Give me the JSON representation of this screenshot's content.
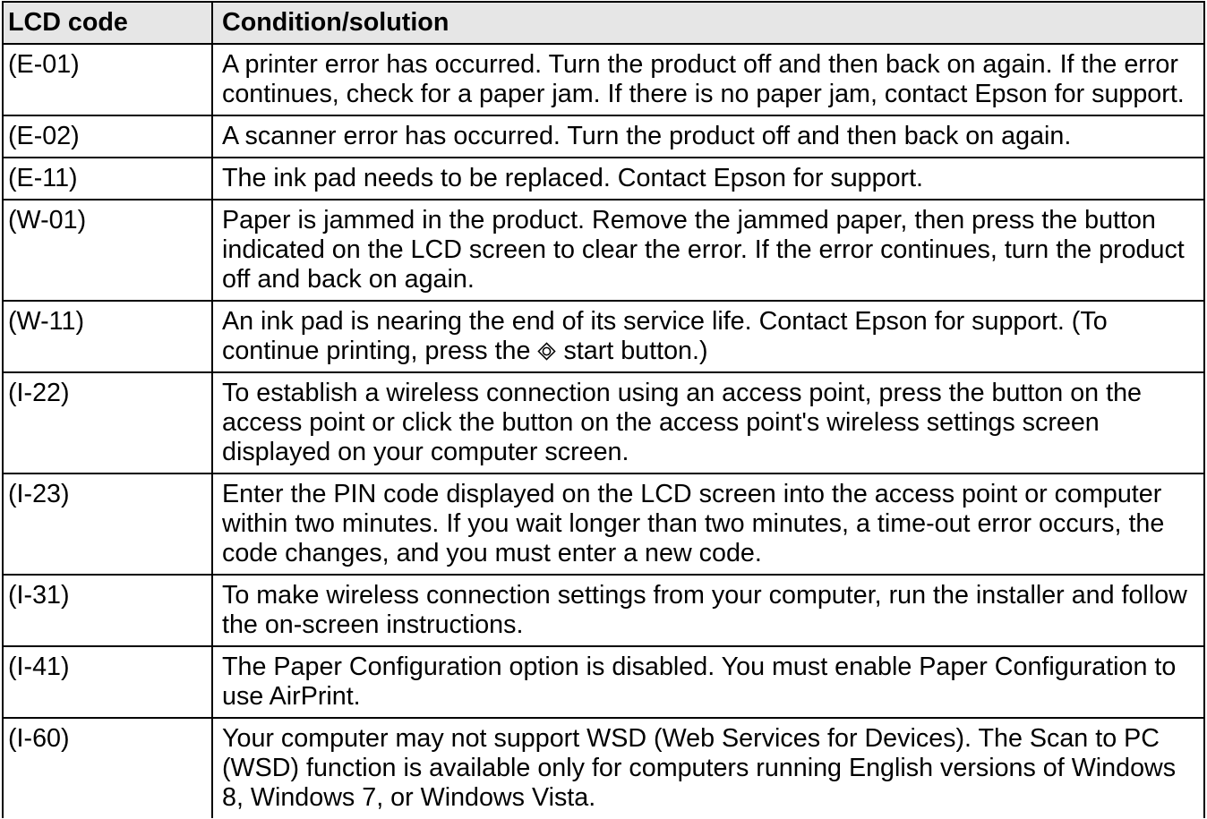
{
  "colors": {
    "header_background": "#e6e6e6",
    "border": "#000000",
    "text": "#000000"
  },
  "table": {
    "headers": {
      "code": "LCD code",
      "solution": "Condition/solution"
    },
    "rows": [
      {
        "code": "(E-01)",
        "solution_lines": [
          "A printer error has occurred. Turn the product off and then back on again. If the error",
          "continues, check for a paper jam. If there is no paper jam, contact Epson for support."
        ]
      },
      {
        "code": "(E-02)",
        "solution_lines": [
          "A scanner error has occurred. Turn the product off and then back on again."
        ]
      },
      {
        "code": "(E-11)",
        "solution_lines": [
          "The ink pad needs to be replaced. Contact Epson for support."
        ]
      },
      {
        "code": "(W-01)",
        "solution_lines": [
          "Paper is jammed in the product. Remove the jammed paper, then press the button",
          "indicated on the LCD screen to clear the error. If the error continues, turn the product",
          "off and back on again."
        ]
      },
      {
        "code": "(W-11)",
        "solution_lines": [
          "An ink pad is nearing the end of its service life. Contact Epson for support. (To"
        ],
        "icon_line": {
          "before": "continue printing, press the",
          "icon": "start-icon",
          "after": "start button.)"
        }
      },
      {
        "code": "(I-22)",
        "solution_lines": [
          "To establish a wireless connection using an access point, press the button on the",
          "access point or click the button on the access point's wireless settings screen",
          "displayed on your computer screen."
        ]
      },
      {
        "code": "(I-23)",
        "solution_lines": [
          "Enter the PIN code displayed on the LCD screen into the access point or computer",
          "within two minutes. If you wait longer than two minutes, a time-out error occurs, the",
          "code changes, and you must enter a new code."
        ]
      },
      {
        "code": "(I-31)",
        "solution_lines": [
          "To make wireless connection settings from your computer, run the installer and follow",
          "the on-screen instructions."
        ]
      },
      {
        "code": "(I-41)",
        "solution_lines": [
          "The Paper Configuration option is disabled. You must enable Paper Configuration to",
          "use AirPrint."
        ]
      },
      {
        "code": "(I-60)",
        "solution_lines": [
          "Your computer may not support WSD (Web Services for Devices). The Scan to PC",
          "(WSD) function is available only for computers running English versions of Windows",
          "8, Windows 7, or Windows Vista."
        ]
      }
    ]
  }
}
